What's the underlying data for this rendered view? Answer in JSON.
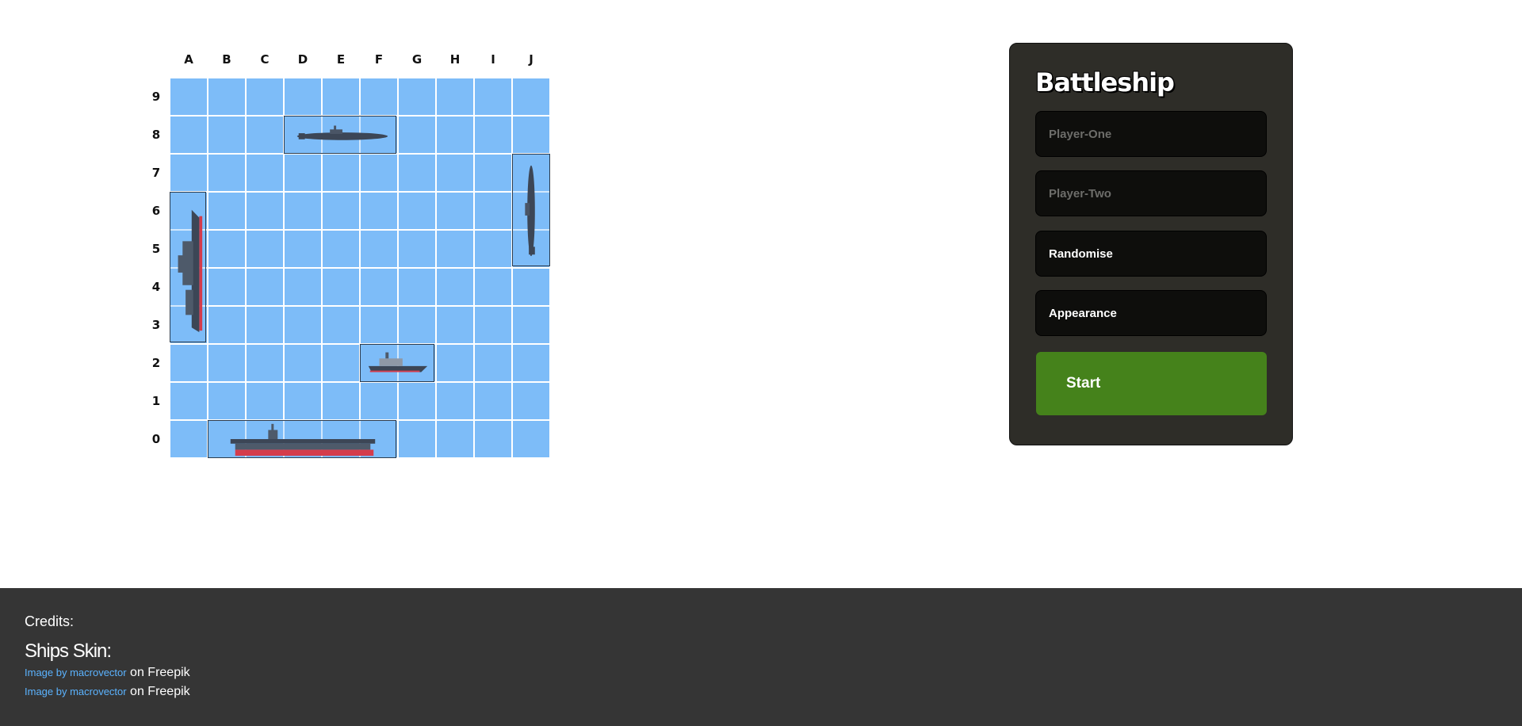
{
  "board": {
    "columns": [
      "A",
      "B",
      "C",
      "D",
      "E",
      "F",
      "G",
      "H",
      "I",
      "J"
    ],
    "rows": [
      "9",
      "8",
      "7",
      "6",
      "5",
      "4",
      "3",
      "2",
      "1",
      "0"
    ]
  },
  "panel": {
    "title": "Battleship",
    "player_one_placeholder": "Player-One",
    "player_two_placeholder": "Player-Two",
    "randomise_label": "Randomise",
    "appearance_label": "Appearance",
    "start_label": "Start"
  },
  "footer": {
    "credits_title": "Credits:",
    "skins_heading": "Ships Skin:",
    "credits": [
      {
        "link_text": "Image by macrovector",
        "suffix": " on Freepik"
      },
      {
        "link_text": "Image by macrovector",
        "suffix": " on Freepik"
      }
    ]
  },
  "colors": {
    "water": "#7dbcf8",
    "panel_bg": "#2e2d28",
    "start_button": "#45821b",
    "footer_bg": "#353535",
    "link": "#5bb3ff"
  }
}
